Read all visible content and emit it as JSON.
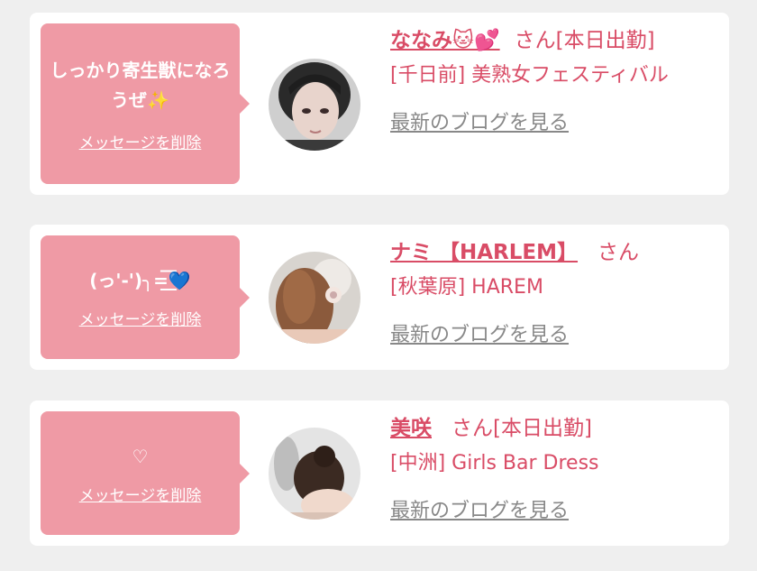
{
  "colors": {
    "page_bg": "#efefef",
    "card_bg": "#ffffff",
    "bubble_bg": "#ef9aa5",
    "accent_text": "#d94c66",
    "link_gray": "#888888"
  },
  "messages": [
    {
      "bubble_text": "しっかり寄生獣になろうぜ✨",
      "delete_label": "メッセージを削除",
      "name": "ななみ🐱💕",
      "honorific": "さん[本日出勤]",
      "shop": "[千日前] 美熟女フェスティバル",
      "blog_link": "最新のブログを見る",
      "avatar_icon": "avatar-photo"
    },
    {
      "bubble_text": "(っ'-')╮=͟͟͞͞💙",
      "delete_label": "メッセージを削除",
      "name": "ナミ 【HARLEM】",
      "honorific": "さん",
      "shop": "[秋葉原] HAREM",
      "blog_link": "最新のブログを見る",
      "avatar_icon": "avatar-photo"
    },
    {
      "bubble_text": "♡",
      "delete_label": "メッセージを削除",
      "name": "美咲",
      "honorific": "さん[本日出勤]",
      "shop": "[中洲] Girls Bar Dress",
      "blog_link": "最新のブログを見る",
      "avatar_icon": "avatar-photo"
    }
  ]
}
